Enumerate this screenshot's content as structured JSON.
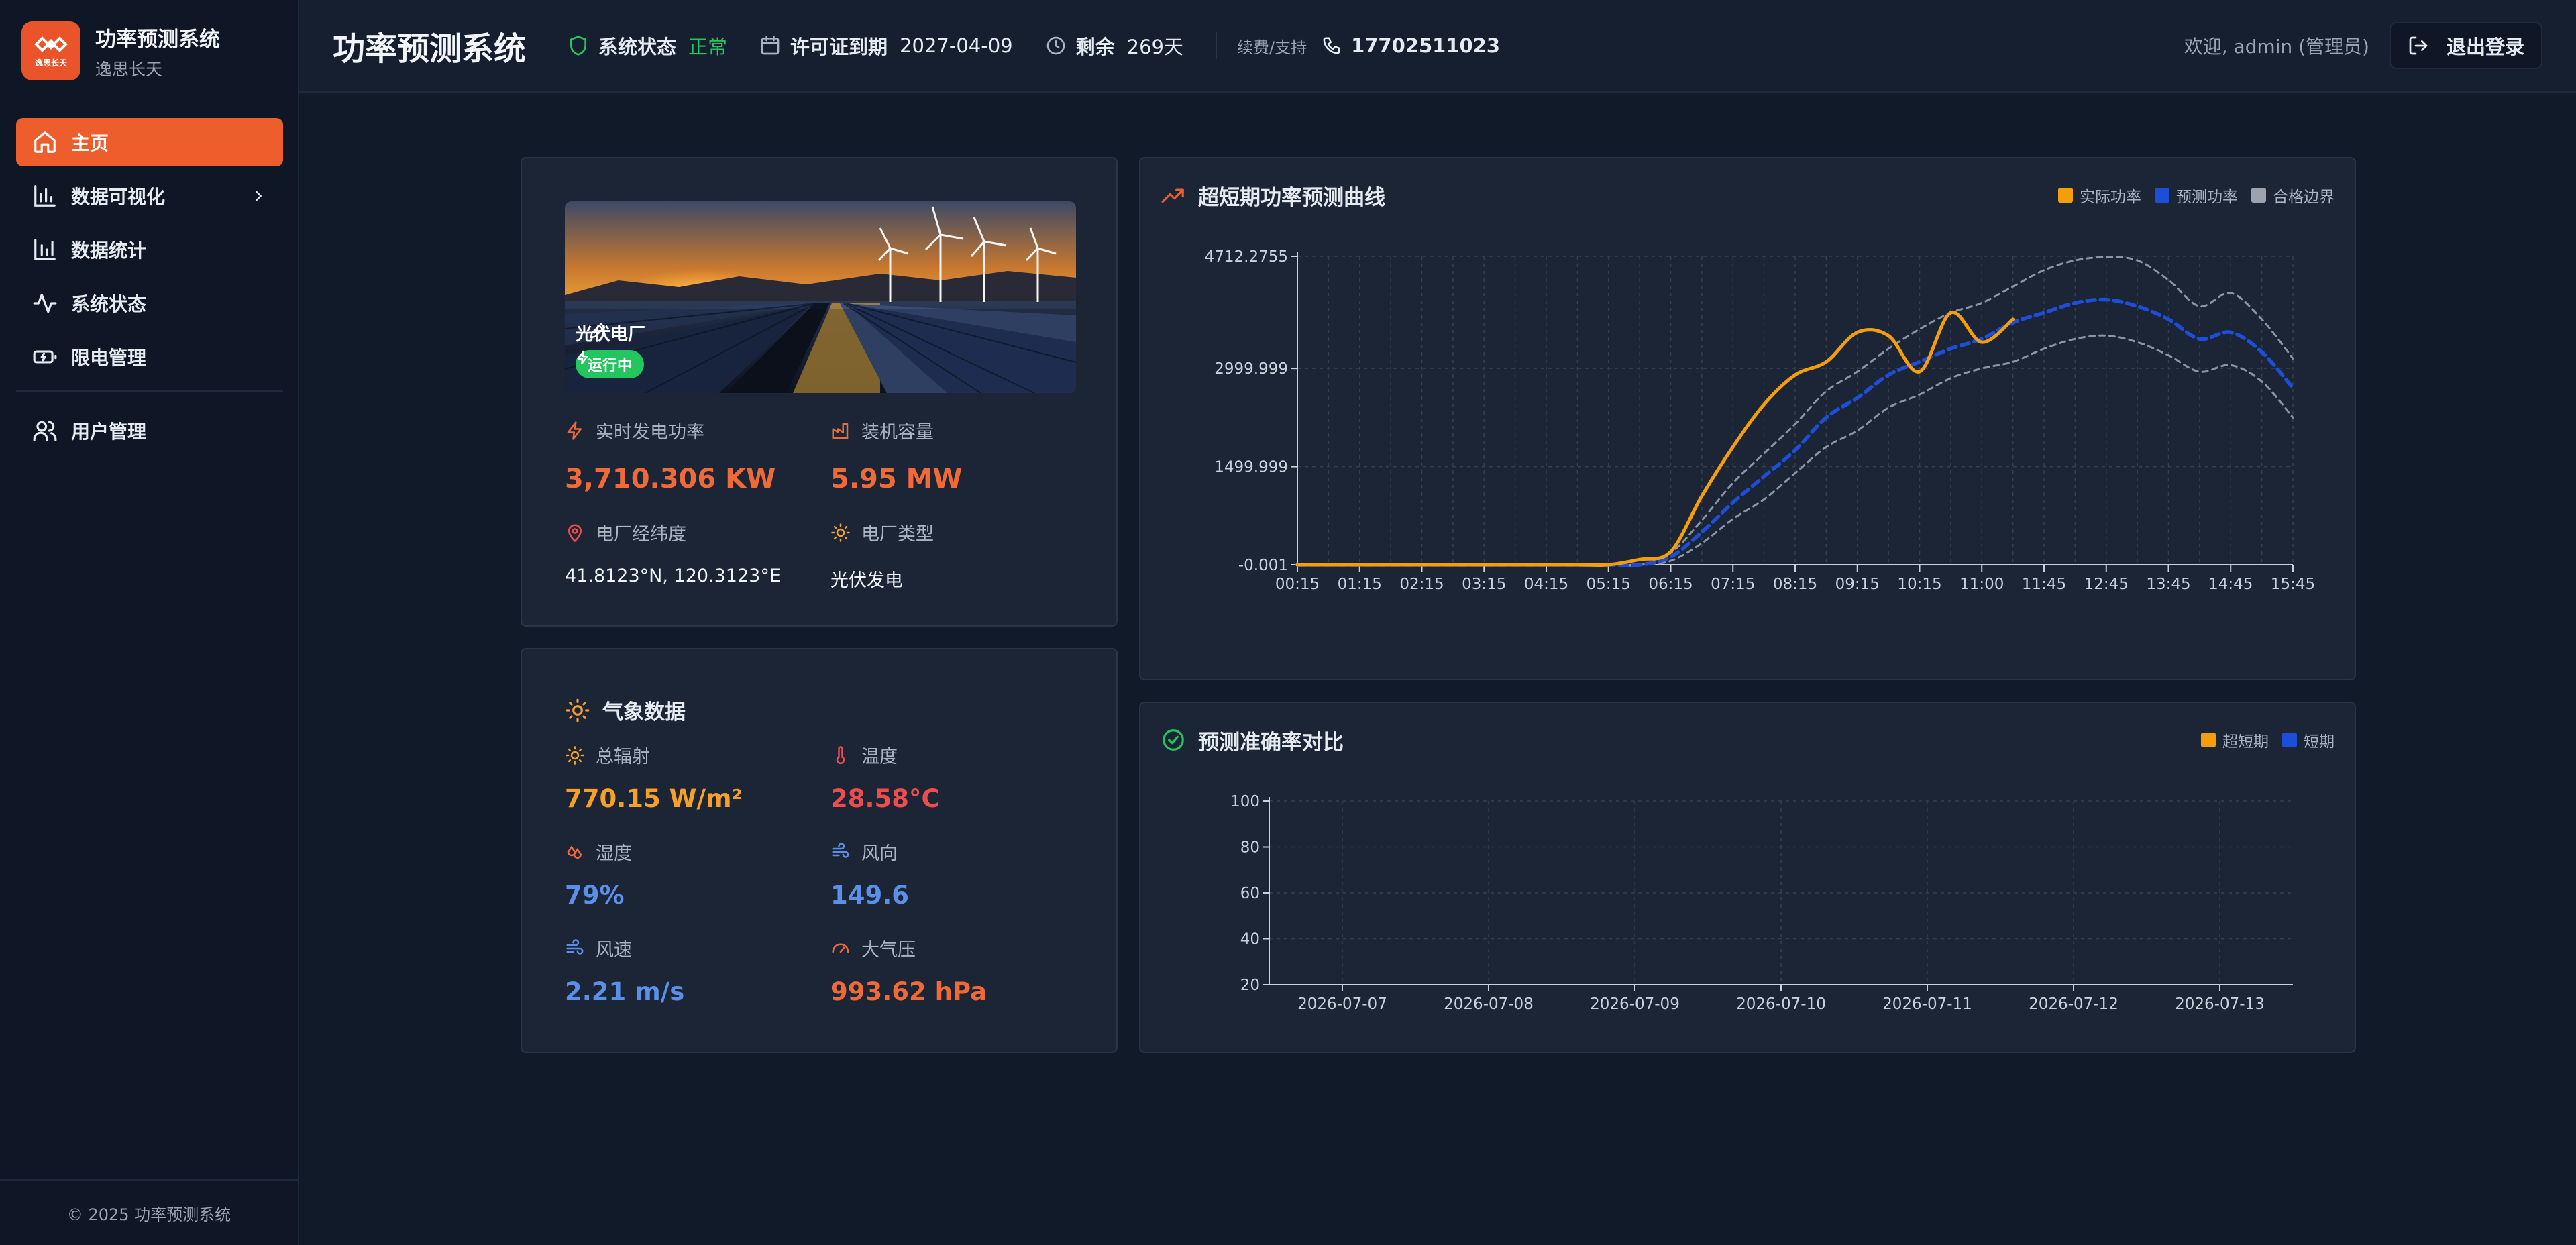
{
  "sidebar": {
    "brand_title": "功率预测系统",
    "brand_subtitle": "逸思长天",
    "logo_text": "逸思长天",
    "items": [
      {
        "label": "主页",
        "icon": "home-icon",
        "active": true
      },
      {
        "label": "数据可视化",
        "icon": "bar-chart-icon",
        "has_children": true
      },
      {
        "label": "数据统计",
        "icon": "bar-stats-icon"
      },
      {
        "label": "系统状态",
        "icon": "activity-icon"
      },
      {
        "label": "限电管理",
        "icon": "battery-icon"
      },
      {
        "label": "用户管理",
        "icon": "users-icon"
      }
    ],
    "footer": "© 2025 功率预测系统"
  },
  "header": {
    "title": "功率预测系统",
    "status_label": "系统状态",
    "status_value": "正常",
    "license_label": "许可证到期",
    "license_value": "2027-04-09",
    "remaining_label": "剩余",
    "remaining_value": "269天",
    "support_label": "续费/支持",
    "phone": "17702511023",
    "welcome": "欢迎, admin (管理员)",
    "logout": "退出登录"
  },
  "plant": {
    "name": "光伏电厂",
    "status": "运行中",
    "realtime_power_label": "实时发电功率",
    "realtime_power_value": "3,710.306 KW",
    "capacity_label": "装机容量",
    "capacity_value": "5.95 MW",
    "coords_label": "电厂经纬度",
    "coords_value": "41.8123°N, 120.3123°E",
    "type_label": "电厂类型",
    "type_value": "光伏发电"
  },
  "weather": {
    "title": "气象数据",
    "irradiance_label": "总辐射",
    "irradiance_value": "770.15 W/m²",
    "temperature_label": "温度",
    "temperature_value": "28.58°C",
    "humidity_label": "湿度",
    "humidity_value": "79%",
    "wind_dir_label": "风向",
    "wind_dir_value": "149.6",
    "wind_speed_label": "风速",
    "wind_speed_value": "2.21 m/s",
    "pressure_label": "大气压",
    "pressure_value": "993.62 hPa"
  },
  "colors": {
    "accent": "#ee5e2d",
    "actual": "#f59e0b",
    "forecast": "#1d4ed8",
    "boundary": "#9ca3af",
    "ok": "#22c55e"
  },
  "chart_data": [
    {
      "type": "line",
      "title": "超短期功率预测曲线",
      "x": [
        "00:15",
        "00:45",
        "01:15",
        "01:45",
        "02:15",
        "02:45",
        "03:15",
        "03:45",
        "04:15",
        "04:45",
        "05:15",
        "05:45",
        "06:15",
        "06:45",
        "07:15",
        "07:45",
        "08:15",
        "08:45",
        "09:15",
        "09:45",
        "10:15",
        "10:45",
        "11:00",
        "11:15",
        "11:45",
        "12:15",
        "12:45",
        "13:15",
        "13:45",
        "14:15",
        "14:45",
        "15:15",
        "15:45"
      ],
      "xticks": [
        "00:15",
        "01:15",
        "02:15",
        "03:15",
        "04:15",
        "05:15",
        "06:15",
        "07:15",
        "08:15",
        "09:15",
        "10:15",
        "11:00",
        "11:45",
        "12:45",
        "13:45",
        "14:45",
        "15:45"
      ],
      "yticks": [
        -0.001,
        1499.999,
        2999.999,
        4712.2755
      ],
      "ytick_labels": [
        "-0.001",
        "1499.999",
        "2999.999",
        "4712.2755"
      ],
      "ylim": [
        -0.001,
        4712.2755
      ],
      "grid": true,
      "legend_position": "top-right",
      "series": [
        {
          "name": "实际功率",
          "style": "solid",
          "values": [
            0,
            0,
            0,
            0,
            0,
            0,
            0,
            0,
            0,
            0,
            0,
            80,
            200,
            1050,
            1800,
            2450,
            2900,
            3100,
            3550,
            3500,
            2950,
            3850,
            3400,
            3750,
            null,
            null,
            null,
            null,
            null,
            null,
            null,
            null,
            null
          ]
        },
        {
          "name": "预测功率",
          "style": "dashed",
          "values": [
            0,
            0,
            0,
            0,
            0,
            0,
            0,
            0,
            0,
            0,
            0,
            0,
            120,
            500,
            950,
            1350,
            1750,
            2250,
            2550,
            2900,
            3100,
            3300,
            3450,
            3700,
            3850,
            4000,
            4050,
            3950,
            3750,
            3450,
            3550,
            3250,
            2700
          ]
        },
        {
          "name": "合格边界",
          "style": "dashed",
          "values": [
            0,
            0,
            0,
            0,
            0,
            0,
            0,
            0,
            0,
            0,
            0,
            0,
            180,
            680,
            1250,
            1700,
            2150,
            2650,
            2950,
            3300,
            3600,
            3850,
            4000,
            4250,
            4500,
            4650,
            4700,
            4650,
            4350,
            3950,
            4150,
            3750,
            3150
          ]
        },
        {
          "name": "合格边界",
          "style": "dashed",
          "values": [
            0,
            0,
            0,
            0,
            0,
            0,
            0,
            0,
            0,
            0,
            0,
            0,
            60,
            330,
            700,
            1000,
            1400,
            1800,
            2050,
            2400,
            2600,
            2850,
            3000,
            3100,
            3300,
            3450,
            3500,
            3400,
            3200,
            2950,
            3050,
            2800,
            2250
          ]
        }
      ]
    },
    {
      "type": "line",
      "title": "预测准确率对比",
      "categories": [
        "2026-07-07",
        "2026-07-08",
        "2026-07-09",
        "2026-07-10",
        "2026-07-11",
        "2026-07-12",
        "2026-07-13"
      ],
      "yticks": [
        20,
        40,
        60,
        80,
        100
      ],
      "ylim": [
        20,
        100
      ],
      "grid": true,
      "legend_position": "top-right",
      "series": [
        {
          "name": "超短期",
          "values": []
        },
        {
          "name": "短期",
          "values": []
        }
      ]
    }
  ]
}
